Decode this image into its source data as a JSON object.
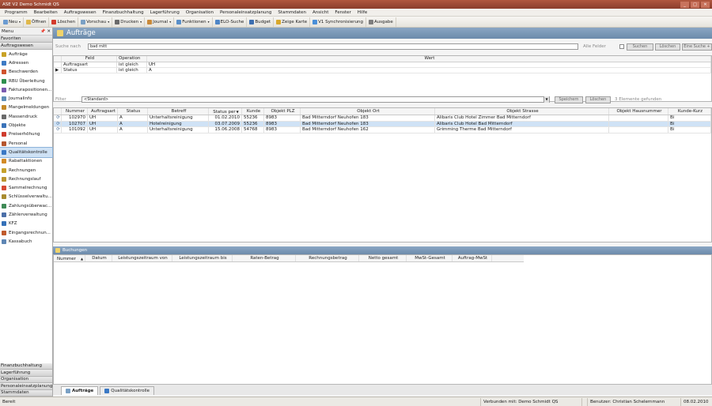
{
  "window": {
    "title": "ASE V2 Demo Schmidt QS",
    "controls": [
      "_",
      "□",
      "✕"
    ]
  },
  "menu": [
    "Programm",
    "Bearbeiten",
    "Auftragswesen",
    "Finanzbuchhaltung",
    "Lagerführung",
    "Organisation",
    "Personaleinsatzplanung",
    "Stammdaten",
    "Ansicht",
    "Fenster",
    "Hilfe"
  ],
  "toolbar": [
    {
      "label": "Neu",
      "icon": "new-icon",
      "color": "#6b9bd1",
      "dropdown": true
    },
    {
      "label": "Öffnen",
      "icon": "folder-icon",
      "color": "#e0b84a",
      "dropdown": false
    },
    {
      "label": "Löschen",
      "icon": "delete-icon",
      "color": "#d33b2c",
      "dropdown": false
    },
    {
      "label": "Vorschau",
      "icon": "preview-icon",
      "color": "#7aa0c4",
      "dropdown": true
    },
    {
      "label": "Drucken",
      "icon": "printer-icon",
      "color": "#6a6a6a",
      "dropdown": true
    },
    {
      "label": "Journal",
      "icon": "journal-icon",
      "color": "#c98a3a",
      "dropdown": true
    },
    {
      "label": "Funktionen",
      "icon": "functions-icon",
      "color": "#5a8fc8",
      "dropdown": true
    },
    {
      "label": "ELO-Suche",
      "icon": "elo-search-icon",
      "color": "#4f86c6",
      "dropdown": false
    },
    {
      "label": "Budget",
      "icon": "budget-icon",
      "color": "#3d6fb0",
      "dropdown": false
    },
    {
      "label": "Zeige Karte",
      "icon": "map-icon",
      "color": "#d9a82c",
      "dropdown": false
    },
    {
      "label": "V1 Synchronisierung",
      "icon": "sync-icon",
      "color": "#4a8fd8",
      "dropdown": false
    },
    {
      "label": "Ausgabe",
      "icon": "output-icon",
      "color": "#7d7d7d",
      "dropdown": false
    }
  ],
  "sidebar": {
    "header": "Menu",
    "pin": "📌",
    "close": "✕",
    "favorites_label": "Favoriten",
    "category": "Auftragswesen",
    "items": [
      {
        "label": "Aufträge",
        "icon": "orders-icon",
        "color": "#c9a227",
        "selected": false
      },
      {
        "label": "Adressen",
        "icon": "addresses-icon",
        "color": "#3d7ac4",
        "selected": false
      },
      {
        "label": "Beschwerden",
        "icon": "complaints-icon",
        "color": "#d0532d",
        "selected": false
      },
      {
        "label": "RBU Überleitung",
        "icon": "transfer-icon",
        "color": "#2f8f4e",
        "selected": false
      },
      {
        "label": "Fakturapositionen...",
        "icon": "invoice-items-icon",
        "color": "#7b5bb0",
        "selected": false
      },
      {
        "label": "Journalinfo",
        "icon": "journal-info-icon",
        "color": "#5f8fb8",
        "selected": false
      },
      {
        "label": "Mangelmeldungen",
        "icon": "defect-icon",
        "color": "#c48a2a",
        "selected": false
      },
      {
        "label": "Massendruck",
        "icon": "mass-print-icon",
        "color": "#6a6a6a",
        "selected": false
      },
      {
        "label": "Objekte",
        "icon": "objects-icon",
        "color": "#3b73b9",
        "selected": false
      },
      {
        "label": "Preiserhöhung",
        "icon": "price-icon",
        "color": "#cf3c2e",
        "selected": false
      },
      {
        "label": "Personal",
        "icon": "personnel-icon",
        "color": "#b5562f",
        "selected": false
      },
      {
        "label": "Qualitätskontrolle",
        "icon": "quality-star-icon",
        "color": "#3a78c4",
        "selected": true
      },
      {
        "label": "Rabattaktionen",
        "icon": "discount-icon",
        "color": "#d28a26",
        "selected": false
      },
      {
        "label": "Rechnungen",
        "icon": "invoices-icon",
        "color": "#c6a12b",
        "selected": false
      },
      {
        "label": "Rechnungslauf",
        "icon": "invoice-run-icon",
        "color": "#bb9530",
        "selected": false
      },
      {
        "label": "Sammelrechnung",
        "icon": "collective-invoice-icon",
        "color": "#d64a33",
        "selected": false
      },
      {
        "label": "Schlüsselverwaltu...",
        "icon": "key-icon",
        "color": "#a88b2f",
        "selected": false
      },
      {
        "label": "Zahlungsüberwac...",
        "icon": "payment-monitor-icon",
        "color": "#3f8a56",
        "selected": false
      },
      {
        "label": "Zählerverwaltung",
        "icon": "meter-icon",
        "color": "#4b6fa8",
        "selected": false
      },
      {
        "label": "KFZ",
        "icon": "car-icon",
        "color": "#3571b8",
        "selected": false
      },
      {
        "label": "Eingangsrechnun...",
        "icon": "incoming-invoice-icon",
        "color": "#c05a2c",
        "selected": false
      },
      {
        "label": "Kassabuch",
        "icon": "cashbook-icon",
        "color": "#5e86b4",
        "selected": false
      }
    ],
    "bottom_categories": [
      "Finanzbuchhaltung",
      "Lagerführung",
      "Organisation",
      "Personaleinsatzplanung",
      "Stammdaten"
    ]
  },
  "panel": {
    "title": "Aufträge",
    "icon": "orders-panel-icon"
  },
  "search": {
    "label": "Suche nach",
    "value": "bad mitt",
    "all_fields_label": "Alle Felder",
    "search_button": "Suchen",
    "delete_button": "Löschen",
    "single_search_button": "Eine Suche +"
  },
  "conditions": {
    "columns": [
      "Feld",
      "Operation",
      "Wert"
    ],
    "rows": [
      {
        "marker": "",
        "feld": "Auftragsart",
        "operation": "ist gleich",
        "wert": "UH"
      },
      {
        "marker": "▶",
        "feld": "Status",
        "operation": "ist gleich",
        "wert": "A"
      }
    ]
  },
  "filter": {
    "label": "Filter",
    "value": "<Standard>",
    "button": "Speichern",
    "delete_button": "Löschen",
    "result_text": "3 Elemente gefunden"
  },
  "orders": {
    "columns": [
      "",
      "Nummer",
      "Auftragsart",
      "Status",
      "Betreff",
      "Status per",
      "Kunde",
      "Objekt PLZ",
      "Objekt Ort",
      "Objekt Strasse",
      "Objekt Hausnummer",
      "Kunde-Kurz"
    ],
    "sort_indicator": "▼",
    "rows": [
      {
        "nummer": "102970",
        "art": "UH",
        "status": "A",
        "betreff": "Unterhaltsreinigung",
        "status_per": "01.02.2010",
        "kunde": "55236",
        "plz": "8983",
        "ort": "Bad Mitterndorf Neuhofen 183",
        "strasse": "Alibaris Club Hotel Zimmer Bad Mitterndorf",
        "hausnummer": "",
        "kunde_kurz": "Bi",
        "selected": false
      },
      {
        "nummer": "102707",
        "art": "UH",
        "status": "A",
        "betreff": "Hotelreinigung",
        "status_per": "03.07.2009",
        "kunde": "55236",
        "plz": "8983",
        "ort": "Bad Mitterndorf Neuhofen 183",
        "strasse": "Alibaris Club Hotel Bad Mitterndorf",
        "hausnummer": "",
        "kunde_kurz": "Bi",
        "selected": true
      },
      {
        "nummer": "101092",
        "art": "UH",
        "status": "A",
        "betreff": "Unterhaltsreinigung",
        "status_per": "15.06.2008",
        "kunde": "54768",
        "plz": "8983",
        "ort": "Bad Mitterndorf Neuhofen 162",
        "strasse": "Grimming Therme Bad Mitterndorf",
        "hausnummer": "",
        "kunde_kurz": "Bi",
        "selected": false
      }
    ]
  },
  "bookings": {
    "title": "Buchungen",
    "columns": [
      "Nummer",
      "Datum",
      "Leistungszeitraum von",
      "Leistungszeitraum bis",
      "Raten-Betrag",
      "Rechnungsbetrag",
      "Netto gesamt",
      "MwSt-Gesamt",
      "Auftrag-MwSt"
    ],
    "sort_indicator": "▲"
  },
  "tabs": [
    {
      "label": "Aufträge",
      "icon": "orders-tab-icon",
      "active": true
    },
    {
      "label": "Qualitätskontrolle",
      "icon": "quality-tab-icon",
      "active": false
    }
  ],
  "statusbar": {
    "left": "Bereit",
    "connection": "Verbunden mit: Demo Schmidt QS",
    "user": "Benutzer: Christian Schelernmann",
    "date": "08.02.2010"
  }
}
